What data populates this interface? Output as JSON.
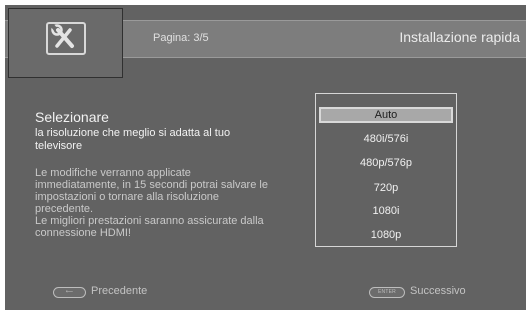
{
  "header": {
    "page": "Pagina: 3/5",
    "title": "Installazione rapida",
    "icon": "settings-wrench-icon"
  },
  "main": {
    "heading": "Selezionare",
    "subheading": "la risoluzione che meglio si adatta al tuo televisore",
    "description": "Le modifiche verranno applicate immediatamente, in 15 secondi potrai salvare le impostazioni o tornare alla risoluzione precedente.\nLe migliori prestazioni saranno assicurate dalla connessione HDMI!"
  },
  "options": {
    "items": [
      "Auto",
      "480i/576i",
      "480p/576p",
      "720p",
      "1080i",
      "1080p"
    ],
    "selected": "Auto"
  },
  "footer": {
    "back_key": "⟵",
    "back_label": "Precedente",
    "enter_key": "ENTER",
    "next_label": "Successivo"
  },
  "colors": {
    "background": "#626262",
    "header": "#7d7d7d",
    "selected_option": "#a8a8a8"
  }
}
